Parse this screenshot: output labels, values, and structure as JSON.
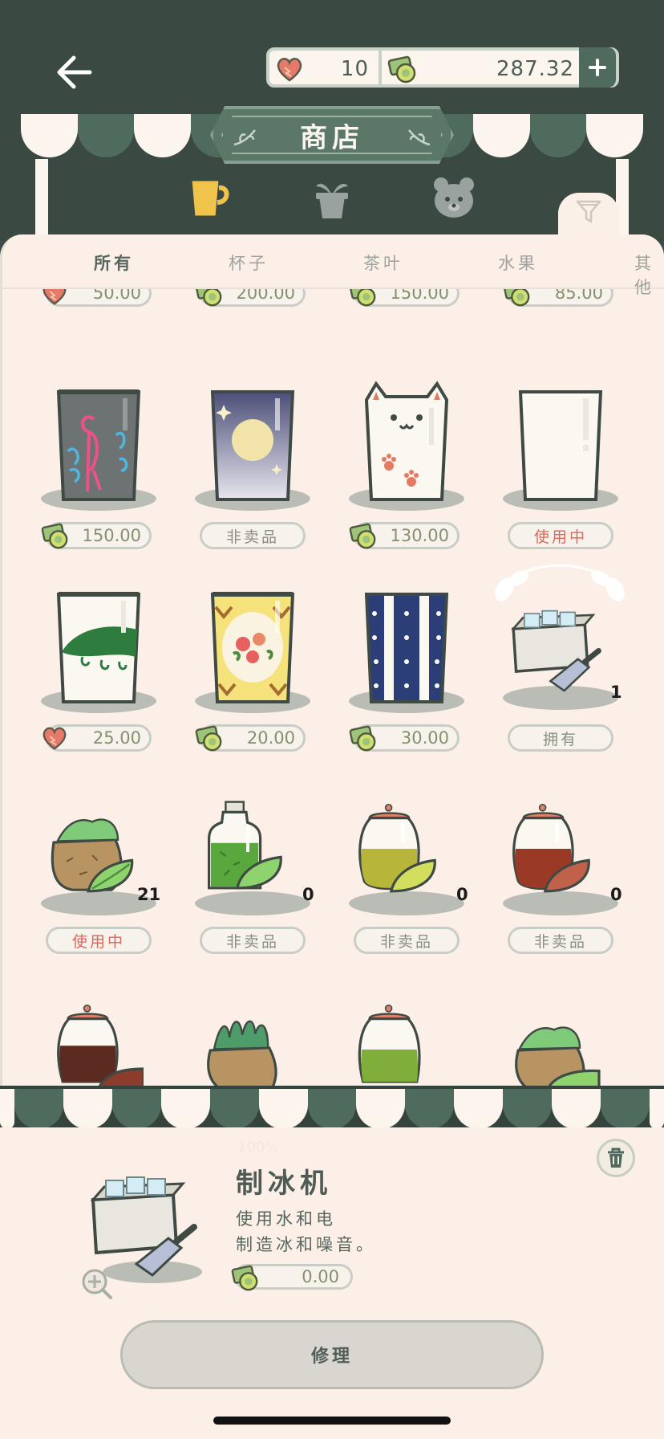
{
  "header": {
    "hearts": "10",
    "cash": "287.32",
    "title": "商店"
  },
  "categories": [
    "cup-icon",
    "plant-icon",
    "bear-icon"
  ],
  "tabs": [
    "所有",
    "杯子",
    "茶叶",
    "水果",
    "其他"
  ],
  "items": {
    "row0": [
      {
        "currency": "heart",
        "price": "50.00"
      },
      {
        "currency": "cash",
        "price": "200.00"
      },
      {
        "currency": "cash",
        "price": "150.00"
      },
      {
        "currency": "cash",
        "price": "85.00"
      }
    ],
    "row1": [
      {
        "name": "flamingo-cup",
        "currency": "cash",
        "price": "150.00"
      },
      {
        "name": "moon-cup",
        "status": "非卖品"
      },
      {
        "name": "cat-cup",
        "currency": "cash",
        "price": "130.00"
      },
      {
        "name": "plain-cup",
        "status": "使用中"
      }
    ],
    "row2": [
      {
        "name": "lily-cup",
        "currency": "heart",
        "price": "25.00"
      },
      {
        "name": "flower-cup",
        "currency": "cash",
        "price": "20.00"
      },
      {
        "name": "stripe-cup",
        "currency": "cash",
        "price": "30.00"
      },
      {
        "name": "ice-maker",
        "count": "1",
        "status": "拥有"
      }
    ],
    "row3": [
      {
        "name": "tea-sack",
        "count": "21",
        "status": "使用中"
      },
      {
        "name": "green-tea-jar",
        "count": "0",
        "status": "非卖品"
      },
      {
        "name": "yellow-tea-jar",
        "count": "0",
        "status": "非卖品"
      },
      {
        "name": "red-tea-jar",
        "count": "0",
        "status": "非卖品"
      }
    ]
  },
  "detail": {
    "percent": "100%",
    "title": "制冰机",
    "desc_line1": "使用水和电",
    "desc_line2": "制造冰和噪音。",
    "price": "0.00",
    "repair_label": "修理"
  },
  "colors": {
    "header_bg": "#3a4a43",
    "panel_bg": "#fcefe8",
    "accent_green": "#4f6b5e",
    "in_use_red": "#e0665a"
  }
}
